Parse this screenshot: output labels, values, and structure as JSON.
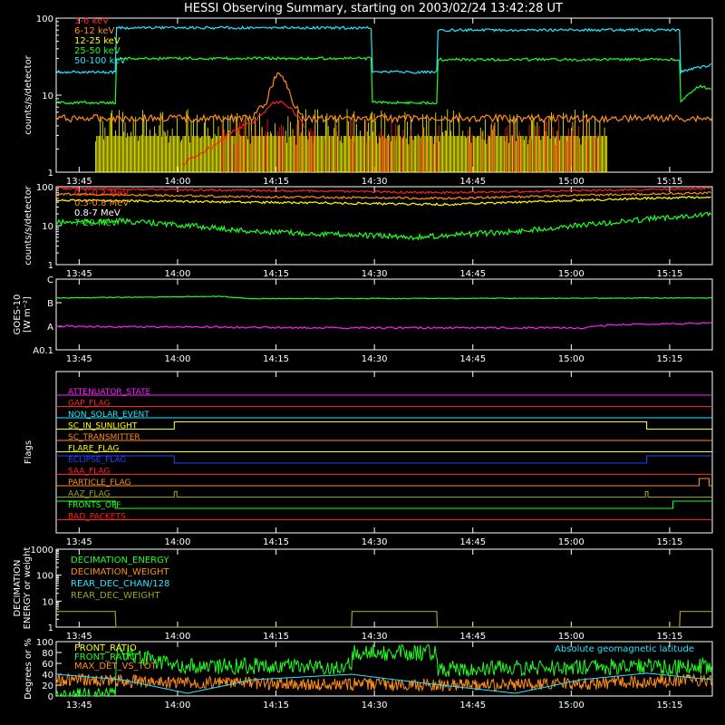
{
  "title": "HESSI Observing Summary, starting on 2003/02/24 13:42:28 UT",
  "time_labels": [
    "13:45",
    "14:00",
    "14:15",
    "14:30",
    "14:45",
    "15:00",
    "15:15"
  ],
  "time_axis_minutes": [
    3.5,
    18.5,
    33.5,
    48.5,
    63.5,
    78.5,
    93.5
  ],
  "colors": {
    "background": "#000000",
    "axes": "#ffffff",
    "red": "#ff2020",
    "orange": "#ff8c1a",
    "yellow": "#ffff00",
    "green": "#20ff20",
    "cyan": "#20e8ff",
    "magenta": "#ff20ff",
    "blue": "#2040ff",
    "olive": "#a0a020",
    "peach": "#ffb070",
    "dark_red": "#e02020"
  },
  "chart_data": [
    {
      "type": "line",
      "title": "HESSI Observing Summary, starting on 2003/02/24 13:42:28 UT",
      "ylabel": "counts/s/detector",
      "yscale": "log",
      "ylim": [
        1,
        100
      ],
      "ytick_labels": [
        "1",
        "10",
        "100"
      ],
      "x_unit": "minutes after 13:42:28",
      "series": [
        {
          "name": "3-6 keV",
          "color": "red",
          "x": [
            19,
            24,
            30,
            33,
            34,
            36,
            38
          ],
          "values": [
            1.2,
            2.2,
            4.5,
            7.5,
            8.5,
            6.5,
            3.5
          ]
        },
        {
          "name": "6-12 keV",
          "color": "orange",
          "x": [
            0,
            6,
            20,
            30,
            34,
            38,
            60,
            83,
            84,
            100
          ],
          "values": [
            0,
            5,
            5,
            6,
            20,
            6,
            5,
            5,
            0,
            0
          ]
        },
        {
          "name": "12-25 keV",
          "color": "yellow",
          "x": [
            0,
            6,
            48,
            58,
            82,
            84,
            100
          ],
          "values": [
            0,
            2,
            2,
            2.5,
            2,
            0,
            0
          ]
        },
        {
          "name": "25-50 keV",
          "color": "green",
          "x": [
            0,
            9,
            9.2,
            48,
            48.2,
            58,
            58.2,
            95,
            95.2,
            98,
            100
          ],
          "values": [
            8,
            8,
            30,
            30,
            8,
            8,
            29,
            29,
            8,
            13,
            12
          ]
        },
        {
          "name": "50-100 keV",
          "color": "cyan",
          "x": [
            0,
            9,
            9.2,
            48,
            48.2,
            58,
            58.2,
            95,
            95.2,
            100
          ],
          "values": [
            20,
            20,
            75,
            75,
            20,
            20,
            70,
            70,
            20,
            25
          ]
        }
      ]
    },
    {
      "type": "line",
      "ylabel": "counts/s/detector",
      "yscale": "log",
      "ylim": [
        1,
        100
      ],
      "ytick_labels": [
        "1",
        "10",
        "100"
      ],
      "x_unit": "minutes after 13:42:28",
      "series": [
        {
          "name": "0.1-0.3 MeV",
          "color": "red",
          "x": [
            0,
            30,
            60,
            100
          ],
          "values": [
            90,
            80,
            70,
            90
          ]
        },
        {
          "name": "0.3-0.8 MeV",
          "color": "orange",
          "x": [
            0,
            30,
            60,
            100
          ],
          "values": [
            65,
            55,
            50,
            70
          ]
        },
        {
          "name": "0.8-7 MeV",
          "color": "yellow",
          "x": [
            0,
            30,
            60,
            100
          ],
          "values": [
            45,
            40,
            35,
            55
          ]
        },
        {
          "name": "7-20 MeV",
          "color": "green",
          "x": [
            0,
            10,
            30,
            55,
            70,
            85,
            100
          ],
          "values": [
            12,
            13,
            7,
            5,
            7,
            12,
            20
          ]
        }
      ]
    },
    {
      "type": "line",
      "ylabel": "GOES-10 [W m-2]",
      "ytick_labels": [
        "A0.1",
        "A",
        "B",
        "C"
      ],
      "x_unit": "minutes after 13:42:28",
      "series": [
        {
          "color": "green",
          "x": [
            0,
            25,
            30,
            100
          ],
          "values": [
            3.3,
            3.4,
            3.25,
            3.3
          ]
        },
        {
          "color": "magenta",
          "x": [
            0,
            45,
            65,
            80,
            85,
            100
          ],
          "values": [
            1.5,
            1.4,
            1.4,
            1.4,
            1.6,
            1.7
          ]
        }
      ]
    },
    {
      "type": "line",
      "ylabel": "Flags",
      "series": [
        {
          "name": "ATTENUATOR_STATE",
          "color": "magenta"
        },
        {
          "name": "GAP_FLAG",
          "color": "red"
        },
        {
          "name": "NON_SOLAR_EVENT",
          "color": "cyan"
        },
        {
          "name": "SC_IN_SUNLIGHT",
          "color": "yellow"
        },
        {
          "name": "SC_TRANSMITTER",
          "color": "orange"
        },
        {
          "name": "FLARE_FLAG",
          "color": "yellow"
        },
        {
          "name": "ECLIPSE_FLAG",
          "color": "blue"
        },
        {
          "name": "SAA_FLAG",
          "color": "red"
        },
        {
          "name": "PARTICLE_FLAG",
          "color": "orange"
        },
        {
          "name": "AAZ_FLAG",
          "color": "olive"
        },
        {
          "name": "FRONTS_OFF",
          "color": "green"
        },
        {
          "name": "BAD_PACKETS",
          "color": "red"
        }
      ]
    },
    {
      "type": "line",
      "ylabel": "DECIMATION ENERGY or weight",
      "yscale": "log",
      "ytick_labels": [
        "1",
        "10",
        "100",
        "1000"
      ],
      "series": [
        {
          "name": "DECIMATION_ENERGY",
          "color": "green"
        },
        {
          "name": "DECIMATION_WEIGHT",
          "color": "orange"
        },
        {
          "name": "REAR_DEC_CHAN/128",
          "color": "cyan"
        },
        {
          "name": "REAR_DEC_WEIGHT",
          "color": "olive",
          "x": [
            0,
            9,
            9.1,
            45,
            45.1,
            58,
            58.1,
            95,
            95.1,
            100
          ],
          "values": [
            4,
            4,
            0,
            0,
            4,
            4,
            0,
            0,
            4,
            4
          ]
        }
      ]
    },
    {
      "type": "line",
      "ylabel": "Degrees or %",
      "ylim": [
        0,
        100
      ],
      "ytick_labels": [
        "0",
        "20",
        "40",
        "60",
        "80",
        "100"
      ],
      "annotation": "Absolute geomagnetic latitude",
      "series": [
        {
          "name": "FRONT_RATIO",
          "color": "yellow"
        },
        {
          "name": "FRONT_RATIO",
          "color": "green",
          "x": [
            0,
            9,
            9.2,
            18,
            45,
            45.2,
            58,
            58.2,
            100
          ],
          "values": [
            0,
            0,
            85,
            55,
            55,
            80,
            80,
            50,
            55
          ]
        },
        {
          "name": "MAX_DET_VS_TOT",
          "color": "orange",
          "x": [
            0,
            20,
            40,
            60,
            80,
            100
          ],
          "values": [
            30,
            25,
            22,
            20,
            22,
            30
          ]
        },
        {
          "name": "Absolute geomagnetic latitude",
          "color": "cyan",
          "x": [
            0,
            10,
            20,
            30,
            45,
            55,
            70,
            80,
            90,
            100
          ],
          "values": [
            40,
            30,
            5,
            30,
            40,
            25,
            5,
            30,
            42,
            30
          ]
        }
      ]
    }
  ]
}
